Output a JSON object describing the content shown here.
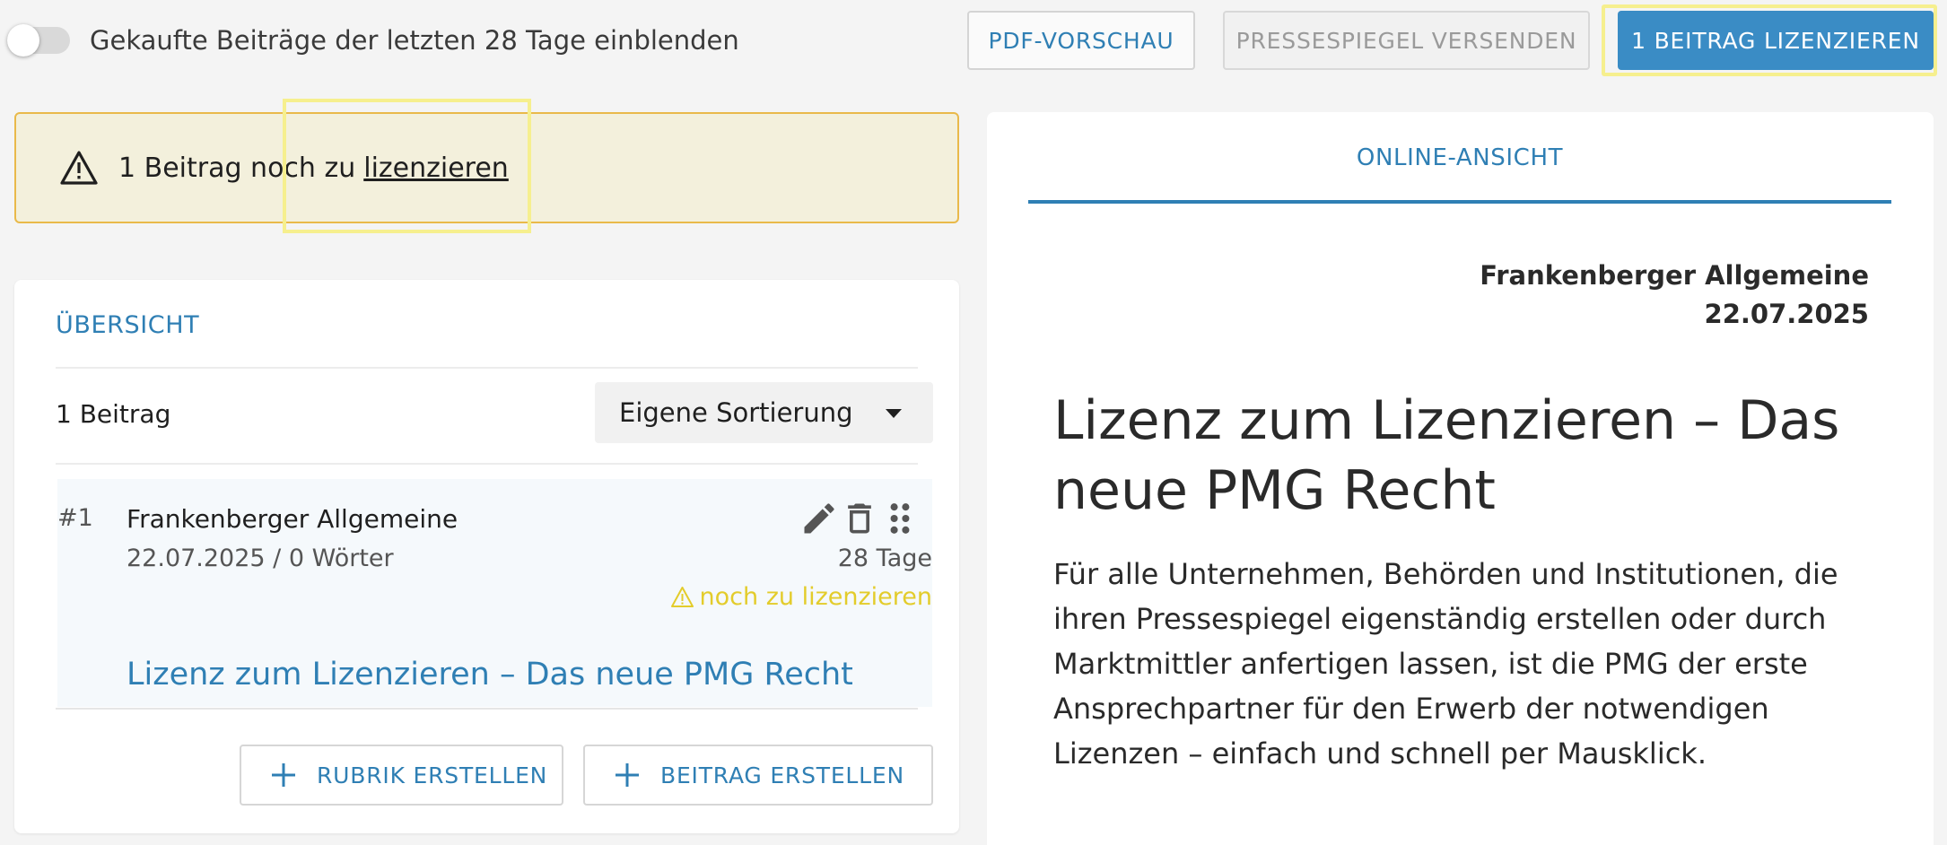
{
  "toolbar": {
    "toggle_label": "Gekaufte Beiträge der letzten 28 Tage einblenden",
    "pdf_preview": "PDF-VORSCHAU",
    "send_press_review": "PRESSESPIEGEL VERSENDEN",
    "license_button": "1 BEITRAG LIZENZIEREN"
  },
  "warning": {
    "message": "1 Beitrag noch zu",
    "link": "lizenzieren"
  },
  "overview": {
    "title": "ÜBERSICHT",
    "count": "1 Beitrag",
    "sort": {
      "selected": "Eigene Sortierung"
    },
    "items": [
      {
        "number": "#1",
        "source": "Frankenberger Allgemeine",
        "meta": "22.07.2025 / 0 Wörter",
        "days": "28 Tage",
        "status": "noch zu lizenzieren",
        "headline": "Lizenz zum Lizenzieren – Das neue PMG Recht"
      }
    ],
    "create_section": "RUBRIK ERSTELLEN",
    "create_article": "BEITRAG ERSTELLEN"
  },
  "online_view": {
    "tab": "ONLINE-ANSICHT",
    "source": "Frankenberger Allgemeine",
    "date": "22.07.2025",
    "title": "Lizenz zum Lizenzieren – Das neue PMG Recht",
    "body": "Für alle Unternehmen, Behörden und Institutionen, die ihren Pressespiegel eigenständig erstellen oder durch Marktmittler anfertigen lassen, ist die PMG der erste Ansprechpartner für den Erwerb der notwendigen Lizenzen – einfach und schnell per Mausklick."
  },
  "colors": {
    "accent": "#2f7fb4",
    "primary_button": "#3a8cc5",
    "warning_bg": "#f3f0dc",
    "warning_border": "#e9b94a",
    "status_yellow": "#e3cc2b",
    "highlight": "#f6ef8e"
  },
  "icons": {
    "warning": "warning-triangle-icon",
    "edit": "pencil-icon",
    "delete": "trash-icon",
    "drag": "drag-handle-icon",
    "add": "plus-icon",
    "sort": "caret-down-icon"
  }
}
